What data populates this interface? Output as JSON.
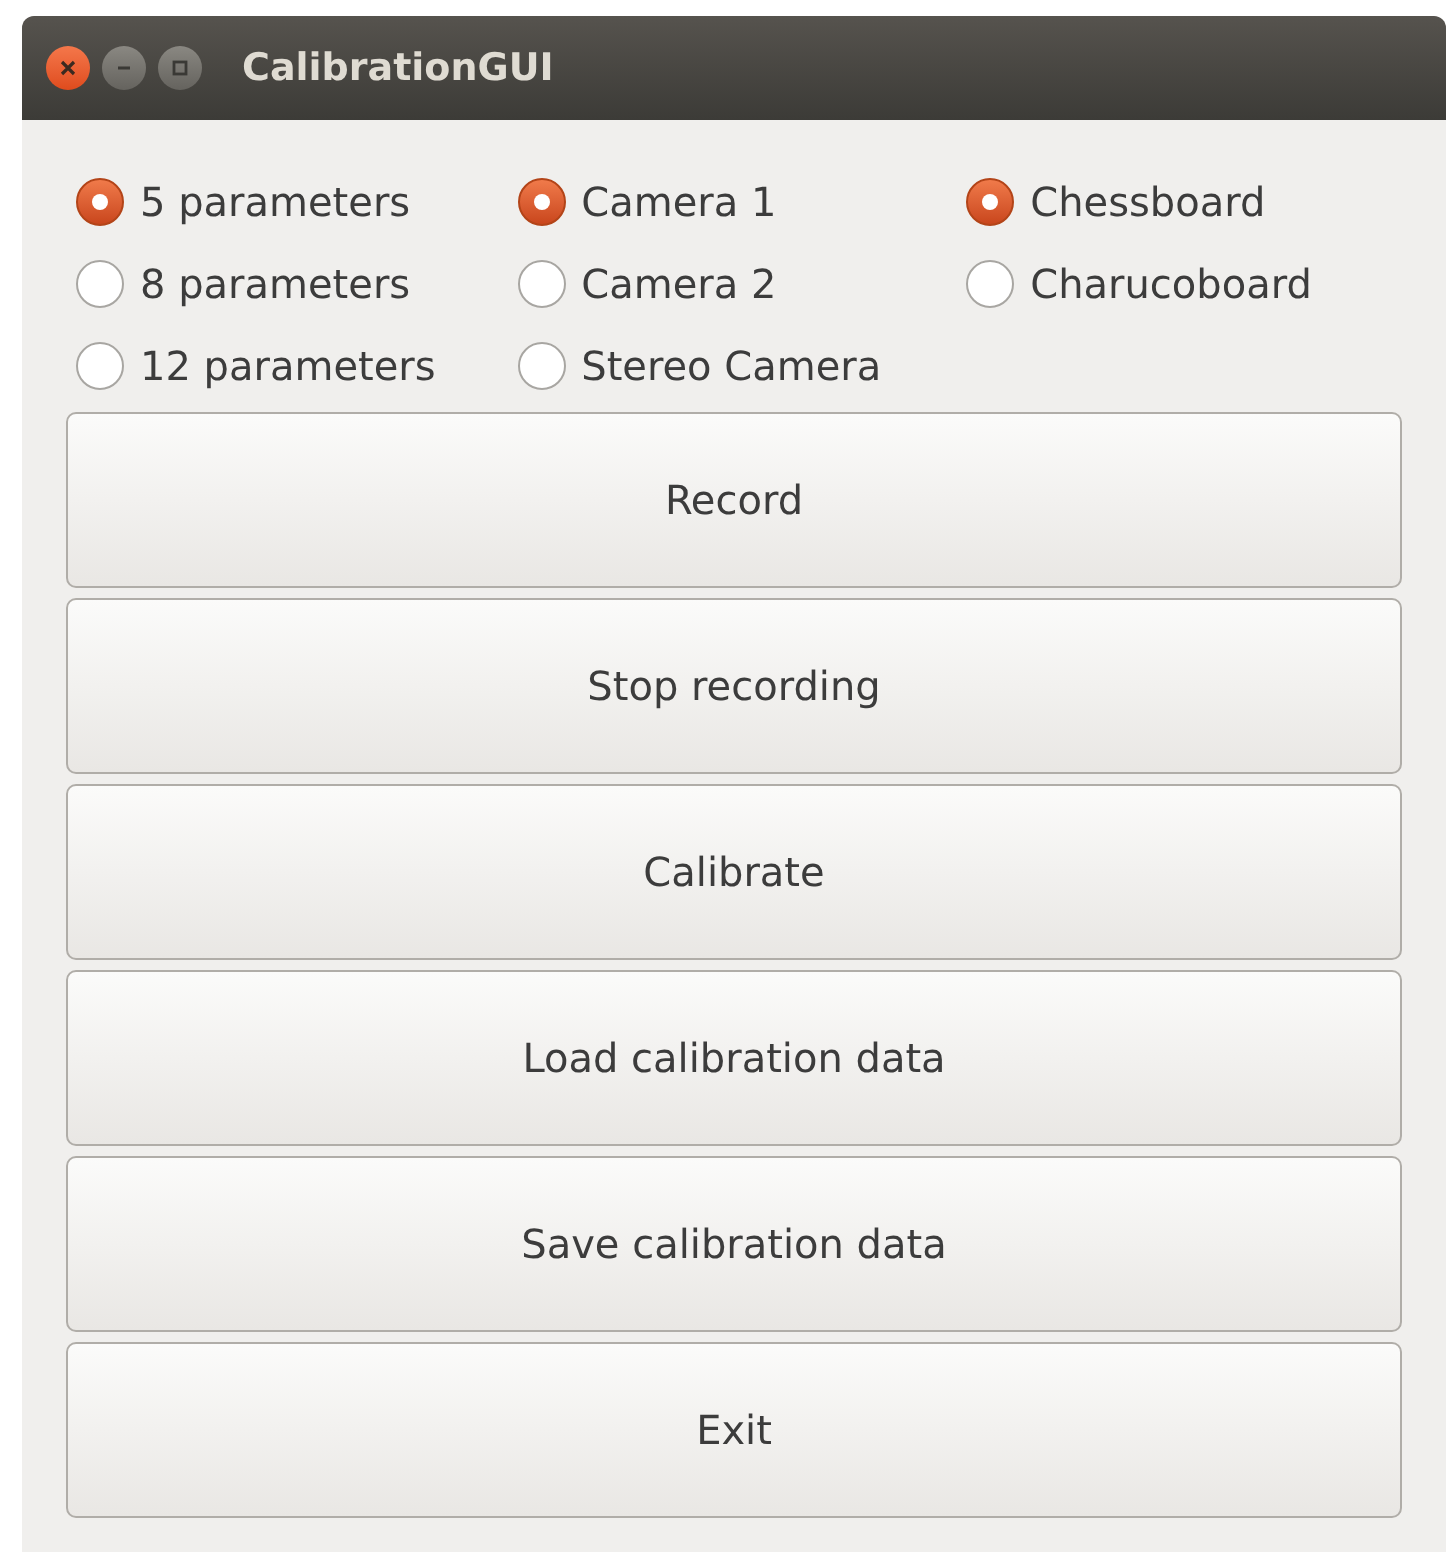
{
  "window": {
    "title": "CalibrationGUI"
  },
  "radio_groups": [
    {
      "options": [
        {
          "label": "5 parameters",
          "selected": true
        },
        {
          "label": "8 parameters",
          "selected": false
        },
        {
          "label": "12 parameters",
          "selected": false
        }
      ]
    },
    {
      "options": [
        {
          "label": "Camera 1",
          "selected": true
        },
        {
          "label": "Camera 2",
          "selected": false
        },
        {
          "label": "Stereo Camera",
          "selected": false
        }
      ]
    },
    {
      "options": [
        {
          "label": "Chessboard",
          "selected": true
        },
        {
          "label": "Charucoboard",
          "selected": false
        }
      ]
    }
  ],
  "buttons": [
    "Record",
    "Stop recording",
    "Calibrate",
    "Load calibration data",
    "Save calibration data",
    "Exit"
  ]
}
